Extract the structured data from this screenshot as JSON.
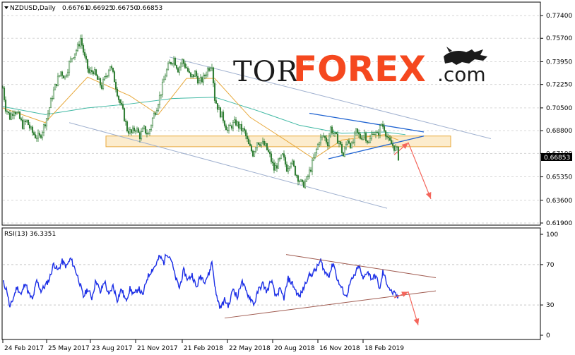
{
  "chart_data": [
    {
      "type": "candlestick",
      "symbol_header": "NZDUSD,Daily",
      "ohlc": [
        "0.66761",
        "0.66925",
        "0.66750",
        "0.66853"
      ],
      "current_price": "0.66853",
      "y_ticks": [
        "0.77400",
        "0.75700",
        "0.73950",
        "0.72250",
        "0.70500",
        "0.68800",
        "0.67100",
        "0.65350",
        "0.63600",
        "0.61900"
      ],
      "y_range": [
        0.619,
        0.774
      ],
      "x_tick_labels": [
        "24 Feb 2017",
        "25 May 2017",
        "23 Aug 2017",
        "21 Nov 2017",
        "21 Feb 2018",
        "22 May 2018",
        "20 Aug 2018",
        "16 Nov 2018",
        "18 Feb 2019"
      ],
      "price_path": [
        [
          0,
          0.72
        ],
        [
          4,
          0.705
        ],
        [
          10,
          0.698
        ],
        [
          16,
          0.704
        ],
        [
          22,
          0.699
        ],
        [
          28,
          0.692
        ],
        [
          34,
          0.695
        ],
        [
          40,
          0.688
        ],
        [
          46,
          0.684
        ],
        [
          52,
          0.683
        ],
        [
          58,
          0.691
        ],
        [
          64,
          0.701
        ],
        [
          70,
          0.714
        ],
        [
          76,
          0.724
        ],
        [
          82,
          0.732
        ],
        [
          88,
          0.728
        ],
        [
          94,
          0.738
        ],
        [
          100,
          0.745
        ],
        [
          106,
          0.75
        ],
        [
          110,
          0.757
        ],
        [
          116,
          0.742
        ],
        [
          122,
          0.731
        ],
        [
          128,
          0.733
        ],
        [
          134,
          0.726
        ],
        [
          140,
          0.721
        ],
        [
          146,
          0.729
        ],
        [
          152,
          0.737
        ],
        [
          158,
          0.726
        ],
        [
          164,
          0.712
        ],
        [
          170,
          0.702
        ],
        [
          176,
          0.689
        ],
        [
          182,
          0.686
        ],
        [
          188,
          0.69
        ],
        [
          194,
          0.684
        ],
        [
          200,
          0.689
        ],
        [
          206,
          0.685
        ],
        [
          212,
          0.697
        ],
        [
          218,
          0.706
        ],
        [
          224,
          0.717
        ],
        [
          230,
          0.73
        ],
        [
          236,
          0.738
        ],
        [
          242,
          0.742
        ],
        [
          248,
          0.734
        ],
        [
          254,
          0.74
        ],
        [
          260,
          0.735
        ],
        [
          266,
          0.727
        ],
        [
          272,
          0.731
        ],
        [
          278,
          0.724
        ],
        [
          284,
          0.727
        ],
        [
          290,
          0.734
        ],
        [
          296,
          0.738
        ],
        [
          300,
          0.712
        ],
        [
          306,
          0.703
        ],
        [
          312,
          0.697
        ],
        [
          318,
          0.688
        ],
        [
          324,
          0.692
        ],
        [
          330,
          0.694
        ],
        [
          336,
          0.69
        ],
        [
          342,
          0.687
        ],
        [
          348,
          0.677
        ],
        [
          354,
          0.671
        ],
        [
          360,
          0.68
        ],
        [
          366,
          0.679
        ],
        [
          372,
          0.676
        ],
        [
          378,
          0.669
        ],
        [
          384,
          0.659
        ],
        [
          390,
          0.664
        ],
        [
          396,
          0.669
        ],
        [
          402,
          0.66
        ],
        [
          408,
          0.666
        ],
        [
          414,
          0.657
        ],
        [
          420,
          0.651
        ],
        [
          424,
          0.647
        ],
        [
          430,
          0.651
        ],
        [
          436,
          0.66
        ],
        [
          442,
          0.67
        ],
        [
          448,
          0.681
        ],
        [
          454,
          0.684
        ],
        [
          460,
          0.679
        ],
        [
          464,
          0.69
        ],
        [
          470,
          0.684
        ],
        [
          476,
          0.68
        ],
        [
          482,
          0.669
        ],
        [
          488,
          0.682
        ],
        [
          494,
          0.676
        ],
        [
          500,
          0.687
        ],
        [
          506,
          0.683
        ],
        [
          512,
          0.686
        ],
        [
          518,
          0.678
        ],
        [
          524,
          0.688
        ],
        [
          530,
          0.684
        ],
        [
          536,
          0.693
        ],
        [
          540,
          0.69
        ],
        [
          546,
          0.68
        ],
        [
          552,
          0.677
        ],
        [
          558,
          0.673
        ],
        [
          560,
          0.6685
        ]
      ],
      "ma_slow_path": [
        [
          0,
          0.706
        ],
        [
          60,
          0.7
        ],
        [
          120,
          0.705
        ],
        [
          180,
          0.708
        ],
        [
          240,
          0.712
        ],
        [
          300,
          0.713
        ],
        [
          360,
          0.703
        ],
        [
          420,
          0.692
        ],
        [
          480,
          0.686
        ],
        [
          540,
          0.687
        ],
        [
          570,
          0.685
        ]
      ],
      "ma_fast_path": [
        [
          0,
          0.705
        ],
        [
          60,
          0.694
        ],
        [
          120,
          0.728
        ],
        [
          180,
          0.714
        ],
        [
          220,
          0.7
        ],
        [
          260,
          0.727
        ],
        [
          300,
          0.727
        ],
        [
          350,
          0.698
        ],
        [
          400,
          0.681
        ],
        [
          440,
          0.667
        ],
        [
          480,
          0.681
        ],
        [
          540,
          0.685
        ],
        [
          560,
          0.681
        ]
      ],
      "channel_upper": [
        [
          240,
          0.743
        ],
        [
          695,
          0.682
        ]
      ],
      "channel_lower": [
        [
          98,
          0.694
        ],
        [
          548,
          0.63
        ]
      ],
      "triangle_upper": [
        [
          438,
          0.701
        ],
        [
          600,
          0.687
        ]
      ],
      "triangle_lower": [
        [
          465,
          0.667
        ],
        [
          600,
          0.684
        ]
      ],
      "support_zone": [
        0.676,
        0.684
      ],
      "support_zone_x": [
        150,
        638
      ],
      "forecast_arrow": [
        [
          558,
          0.67
        ],
        [
          578,
          0.679
        ],
        [
          610,
          0.637
        ]
      ],
      "colors": {
        "candle": "#2e7d32",
        "ma_slow": "#3fb8a3",
        "ma_fast": "#e8a93c",
        "channel": "#9fb0cf",
        "triangle": "#1f63d1",
        "zone_fill": "#fbe7c0",
        "zone_stroke": "#e8a93c",
        "arrow": "#f4655b"
      }
    },
    {
      "type": "line",
      "indicator_header": "RSI(13) 36.3351",
      "y_ticks": [
        "100",
        "70",
        "30",
        "0"
      ],
      "y_range": [
        0,
        100
      ],
      "rsi_path": [
        [
          0,
          53
        ],
        [
          6,
          44
        ],
        [
          10,
          27
        ],
        [
          14,
          35
        ],
        [
          20,
          48
        ],
        [
          26,
          40
        ],
        [
          32,
          53
        ],
        [
          36,
          42
        ],
        [
          42,
          35
        ],
        [
          48,
          54
        ],
        [
          54,
          44
        ],
        [
          60,
          49
        ],
        [
          66,
          56
        ],
        [
          72,
          71
        ],
        [
          78,
          64
        ],
        [
          84,
          73
        ],
        [
          90,
          68
        ],
        [
          96,
          76
        ],
        [
          102,
          66
        ],
        [
          108,
          54
        ],
        [
          114,
          38
        ],
        [
          120,
          46
        ],
        [
          126,
          37
        ],
        [
          132,
          55
        ],
        [
          138,
          42
        ],
        [
          144,
          54
        ],
        [
          150,
          39
        ],
        [
          156,
          49
        ],
        [
          162,
          35
        ],
        [
          168,
          46
        ],
        [
          174,
          34
        ],
        [
          180,
          46
        ],
        [
          186,
          40
        ],
        [
          192,
          47
        ],
        [
          198,
          39
        ],
        [
          204,
          56
        ],
        [
          210,
          64
        ],
        [
          216,
          69
        ],
        [
          222,
          78
        ],
        [
          228,
          72
        ],
        [
          232,
          82
        ],
        [
          238,
          76
        ],
        [
          244,
          58
        ],
        [
          250,
          47
        ],
        [
          256,
          64
        ],
        [
          262,
          55
        ],
        [
          268,
          60
        ],
        [
          274,
          47
        ],
        [
          280,
          59
        ],
        [
          286,
          54
        ],
        [
          292,
          61
        ],
        [
          296,
          73
        ],
        [
          302,
          40
        ],
        [
          308,
          27
        ],
        [
          314,
          35
        ],
        [
          320,
          29
        ],
        [
          326,
          47
        ],
        [
          332,
          37
        ],
        [
          338,
          54
        ],
        [
          344,
          44
        ],
        [
          350,
          37
        ],
        [
          356,
          31
        ],
        [
          362,
          45
        ],
        [
          368,
          51
        ],
        [
          374,
          43
        ],
        [
          380,
          55
        ],
        [
          386,
          38
        ],
        [
          392,
          45
        ],
        [
          398,
          37
        ],
        [
          404,
          56
        ],
        [
          410,
          51
        ],
        [
          416,
          42
        ],
        [
          420,
          38
        ],
        [
          426,
          47
        ],
        [
          432,
          58
        ],
        [
          438,
          61
        ],
        [
          444,
          66
        ],
        [
          450,
          74
        ],
        [
          456,
          62
        ],
        [
          462,
          60
        ],
        [
          468,
          72
        ],
        [
          474,
          54
        ],
        [
          480,
          46
        ],
        [
          486,
          38
        ],
        [
          492,
          52
        ],
        [
          498,
          59
        ],
        [
          504,
          69
        ],
        [
          510,
          55
        ],
        [
          516,
          64
        ],
        [
          522,
          56
        ],
        [
          528,
          59
        ],
        [
          534,
          45
        ],
        [
          538,
          63
        ],
        [
          544,
          51
        ],
        [
          550,
          43
        ],
        [
          556,
          40
        ],
        [
          560,
          37
        ]
      ],
      "rsi_upper_line": [
        [
          405,
          80
        ],
        [
          617,
          57
        ]
      ],
      "rsi_lower_line": [
        [
          318,
          17
        ],
        [
          617,
          44
        ]
      ],
      "forecast_arrow": [
        [
          558,
          37
        ],
        [
          578,
          43
        ],
        [
          592,
          10
        ]
      ],
      "colors": {
        "rsi": "#1c2fe6",
        "trend": "#a05b50",
        "arrow": "#f4655b"
      }
    }
  ],
  "brand": {
    "tor": "TOR",
    "forex": "FOREX",
    "dotcom": ".com"
  }
}
